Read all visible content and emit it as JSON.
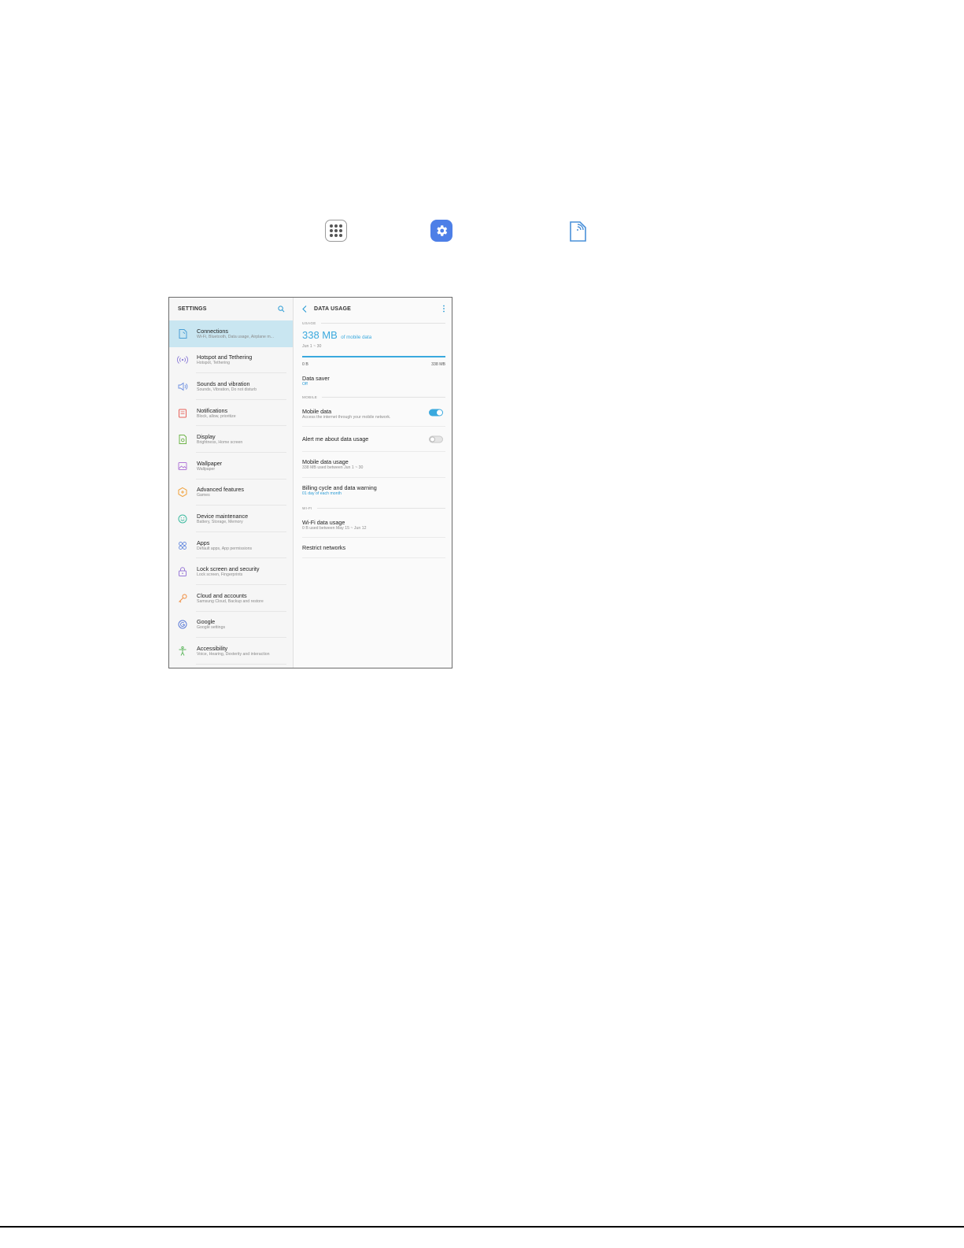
{
  "icons": {
    "apps": "apps-grid-icon",
    "settings": "settings-gear-icon",
    "connections": "connections-icon"
  },
  "left": {
    "title": "SETTINGS",
    "items": [
      {
        "title": "Connections",
        "sub": "Wi-Fi, Bluetooth, Data usage, Airplane m...",
        "icon": "connections-icon",
        "color": "#4a9fd6",
        "selected": true
      },
      {
        "title": "Hotspot and Tethering",
        "sub": "Hotspot, Tethering",
        "icon": "hotspot-icon",
        "color": "#8a7ad8"
      },
      {
        "title": "Sounds and vibration",
        "sub": "Sounds, Vibration, Do not disturb",
        "icon": "speaker-icon",
        "color": "#6a8de0"
      },
      {
        "title": "Notifications",
        "sub": "Block, allow, prioritize",
        "icon": "notifications-icon",
        "color": "#e8625a"
      },
      {
        "title": "Display",
        "sub": "Brightness, Home screen",
        "icon": "display-icon",
        "color": "#6fb54a"
      },
      {
        "title": "Wallpaper",
        "sub": "Wallpaper",
        "icon": "wallpaper-icon",
        "color": "#b27ad8"
      },
      {
        "title": "Advanced features",
        "sub": "Games",
        "icon": "advanced-features-icon",
        "color": "#f0a038"
      },
      {
        "title": "Device maintenance",
        "sub": "Battery, Storage, Memory",
        "icon": "device-maintenance-icon",
        "color": "#3dbba0"
      },
      {
        "title": "Apps",
        "sub": "Default apps, App permissions",
        "icon": "apps-icon",
        "color": "#6a8de0"
      },
      {
        "title": "Lock screen and security",
        "sub": "Lock screen, Fingerprints",
        "icon": "lock-icon",
        "color": "#9a7ad8"
      },
      {
        "title": "Cloud and accounts",
        "sub": "Samsung Cloud, Backup and restore",
        "icon": "cloud-key-icon",
        "color": "#f08a3a"
      },
      {
        "title": "Google",
        "sub": "Google settings",
        "icon": "google-icon",
        "color": "#5a7ad8"
      },
      {
        "title": "Accessibility",
        "sub": "Voice, Hearing, Dexterity and interaction",
        "icon": "accessibility-icon",
        "color": "#5ab55a"
      }
    ]
  },
  "right": {
    "title": "DATA USAGE",
    "usage_label": "USAGE",
    "usage_value": "338 MB",
    "usage_suffix": "of mobile data",
    "usage_period": "Jun 1 ~ 30",
    "usage_fraction": 1.0,
    "range_min": "0 B",
    "range_max": "338 MB",
    "data_saver": {
      "title": "Data saver",
      "sub": "Off"
    },
    "mobile_label": "MOBILE",
    "mobile_data": {
      "title": "Mobile data",
      "sub": "Access the internet through your mobile network.",
      "on": true
    },
    "alert": {
      "title": "Alert me about data usage",
      "on": false
    },
    "mobile_usage": {
      "title": "Mobile data usage",
      "sub": "338 MB used between Jun 1 ~ 30"
    },
    "billing": {
      "title": "Billing cycle and data warning",
      "sub": "01 day of each month"
    },
    "wifi_label": "WI-FI",
    "wifi_usage": {
      "title": "Wi-Fi data usage",
      "sub": "0 B used between May 15 ~ Jun 12"
    },
    "restrict": {
      "title": "Restrict networks"
    }
  },
  "colors": {
    "accent": "#3aa9de",
    "selected_bg": "#c9e6f1",
    "settings_icon_bg": "#4d7fe7"
  }
}
